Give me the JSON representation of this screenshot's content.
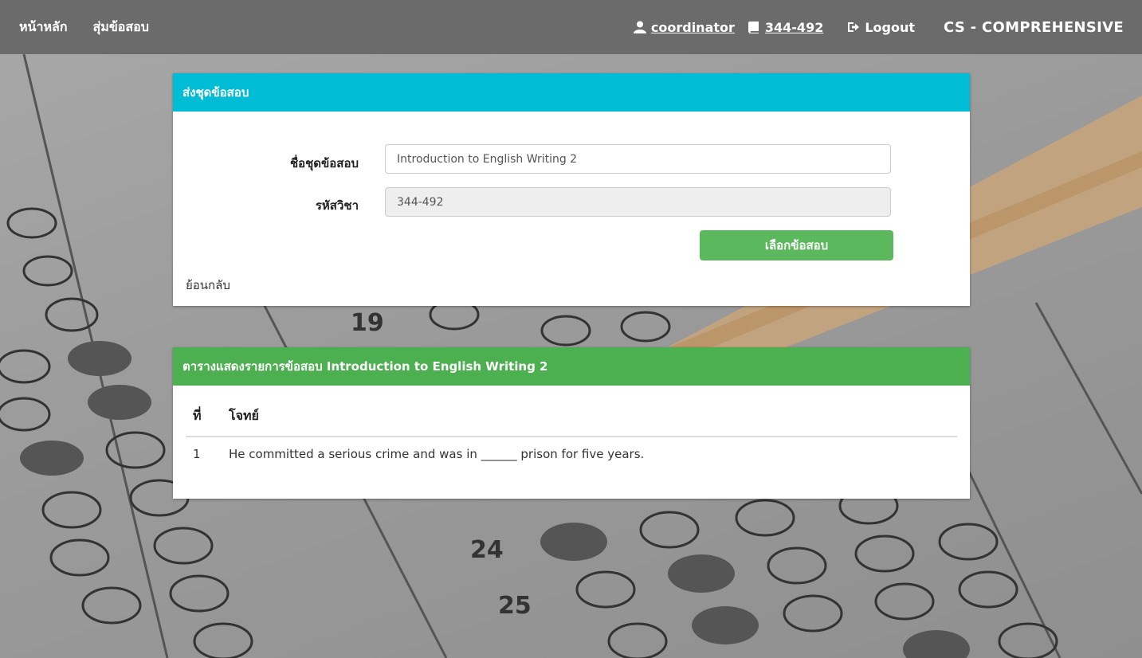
{
  "nav": {
    "home": "หน้าหลัก",
    "random_exam": "สุ่มข้อสอบ",
    "user": "coordinator",
    "course": "344-492",
    "logout": "Logout",
    "brand": "CS - COMPREHENSIVE"
  },
  "send_panel": {
    "title": "ส่งชุดข้อสอบ",
    "exam_set_label": "ชื่อชุดข้อสอบ",
    "exam_set_value": "Introduction to English Writing 2",
    "course_code_label": "รหัสวิชา",
    "course_code_value": "344-492",
    "select_button": "เลือกข้อสอบ",
    "back_link": "ย้อนกลับ"
  },
  "list_panel": {
    "title": "ตารางแสดงรายการข้อสอบ Introduction to English Writing 2",
    "headers": [
      "ที่",
      "โจทย์"
    ],
    "rows": [
      {
        "no": "1",
        "question": "He committed a serious crime and was in ______ prison for five years."
      }
    ]
  },
  "colors": {
    "navbar": "#6b6b6b",
    "info_header": "#00bcd4",
    "success_header": "#4caf50",
    "button": "#5cb85c"
  }
}
